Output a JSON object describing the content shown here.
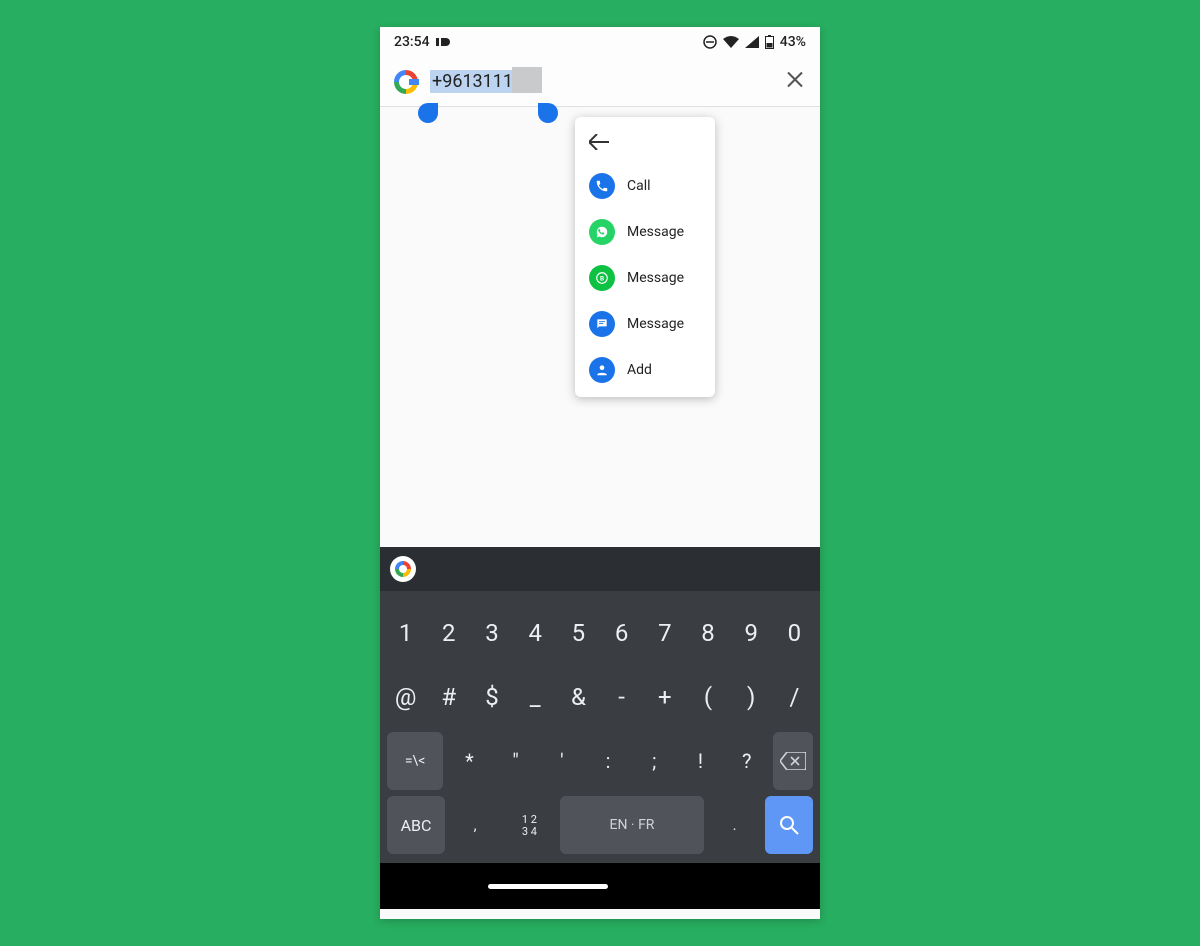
{
  "status": {
    "time": "23:54",
    "battery": "43%"
  },
  "search": {
    "value": "+9613111"
  },
  "popup": {
    "items": [
      {
        "label": "Call",
        "name": "action-call",
        "color": "pi-blue",
        "glyph": "phone"
      },
      {
        "label": "Message",
        "name": "action-message-whatsapp",
        "color": "pi-green",
        "glyph": "wa"
      },
      {
        "label": "Message",
        "name": "action-message-business",
        "color": "pi-green2",
        "glyph": "wb"
      },
      {
        "label": "Message",
        "name": "action-message-sms",
        "color": "pi-blue",
        "glyph": "sms"
      },
      {
        "label": "Add",
        "name": "action-add",
        "color": "pi-blue",
        "glyph": "add"
      }
    ]
  },
  "keyboard": {
    "row1": [
      "1",
      "2",
      "3",
      "4",
      "5",
      "6",
      "7",
      "8",
      "9",
      "0"
    ],
    "row2": [
      "@",
      "#",
      "$",
      "_",
      "&",
      "-",
      "+",
      "(",
      ")",
      "/"
    ],
    "row3_lead": "=\\<",
    "row3": [
      "*",
      "\"",
      "'",
      ":",
      ";",
      "!",
      "?"
    ],
    "row4": {
      "abc": "ABC",
      "comma": ",",
      "nums": [
        "1 2",
        "3 4"
      ],
      "space": "EN · FR",
      "dot": "."
    }
  }
}
